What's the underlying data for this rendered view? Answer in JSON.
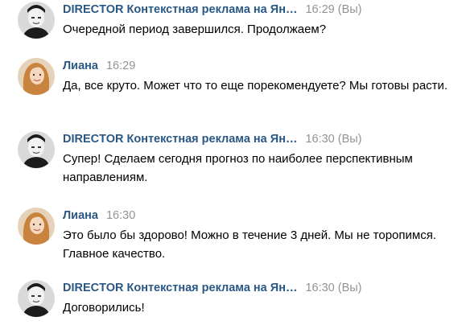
{
  "messages": [
    {
      "author": "DIRECTOR Контекстная реклама на Ян…",
      "time": "16:29",
      "you": "(Вы)",
      "text": "Очередной период завершился. Продолжаем?",
      "avatar": "director-avatar"
    },
    {
      "author": "Лиана",
      "time": "16:29",
      "you": "",
      "text": "Да, все круто. Может что то еще порекомендуете? Мы готовы расти.",
      "avatar": "liana-avatar"
    },
    {
      "author": "DIRECTOR Контекстная реклама на Ян…",
      "time": "16:30",
      "you": "(Вы)",
      "text": "Супер! Сделаем сегодня прогноз по наиболее перспективным направлениям.",
      "avatar": "director-avatar"
    },
    {
      "author": "Лиана",
      "time": "16:30",
      "you": "",
      "text": "Это было бы здорово! Можно в течение 3 дней. Мы не торопимся. Главное качество.",
      "avatar": "liana-avatar"
    },
    {
      "author": "DIRECTOR Контекстная реклама на Ян…",
      "time": "16:30",
      "you": "(Вы)",
      "text": "Договорились!",
      "avatar": "director-avatar"
    }
  ],
  "colors": {
    "author": "#2a5885",
    "time": "#939393",
    "text": "#000000",
    "background": "#ffffff"
  }
}
